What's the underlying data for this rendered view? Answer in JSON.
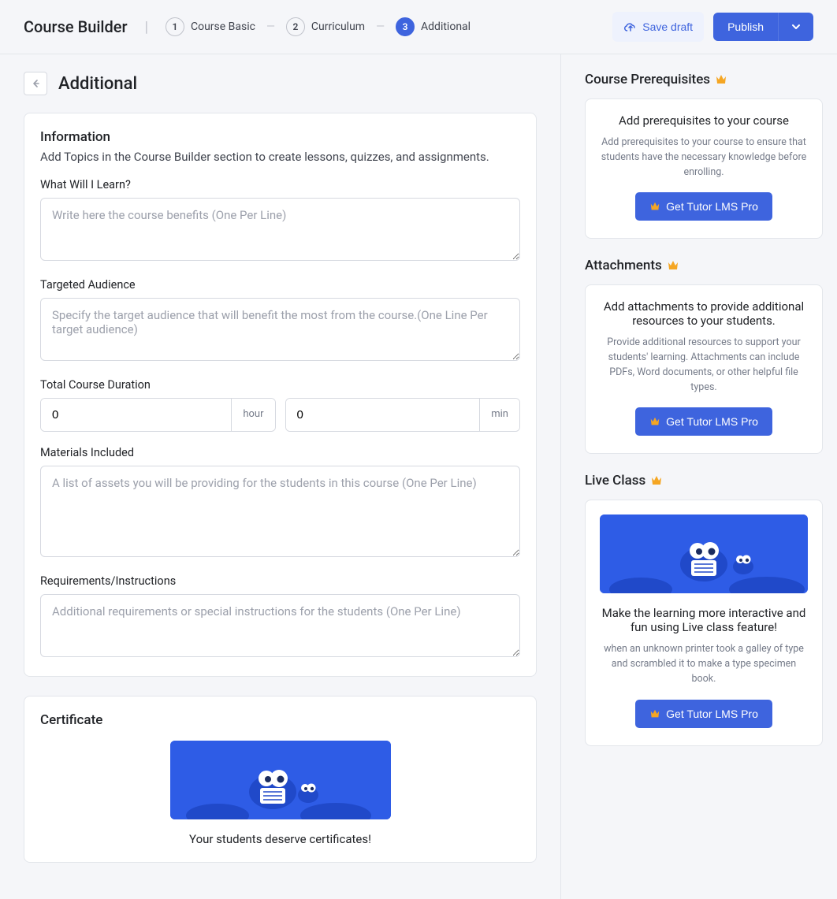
{
  "header": {
    "app_title": "Course Builder",
    "steps": [
      {
        "num": "1",
        "label": "Course Basic"
      },
      {
        "num": "2",
        "label": "Curriculum"
      },
      {
        "num": "3",
        "label": "Additional"
      }
    ],
    "save_draft": "Save draft",
    "publish": "Publish"
  },
  "page_title": "Additional",
  "info_card": {
    "title": "Information",
    "subtitle": "Add Topics in the Course Builder section to create lessons, quizzes, and assignments.",
    "what_learn_label": "What Will I Learn?",
    "what_learn_placeholder": "Write here the course benefits (One Per Line)",
    "audience_label": "Targeted Audience",
    "audience_placeholder": "Specify the target audience that will benefit the most from the course.(One Line Per target audience)",
    "duration_label": "Total Course Duration",
    "hour_value": "0",
    "hour_unit": "hour",
    "min_value": "0",
    "min_unit": "min",
    "materials_label": "Materials Included",
    "materials_placeholder": "A list of assets you will be providing for the students in this course (One Per Line)",
    "reqs_label": "Requirements/Instructions",
    "reqs_placeholder": "Additional requirements or special instructions for the students (One Per Line)"
  },
  "cert_card": {
    "title": "Certificate",
    "caption": "Your students deserve certificates!"
  },
  "side": {
    "prereq": {
      "heading": "Course Prerequisites",
      "title": "Add prerequisites to your course",
      "desc": "Add prerequisites to your course to ensure that students have the necessary knowledge before enrolling.",
      "cta": "Get Tutor LMS Pro"
    },
    "attach": {
      "heading": "Attachments",
      "title": "Add attachments to provide additional resources to your students.",
      "desc": "Provide additional resources to support your students' learning. Attachments can include PDFs, Word documents, or other helpful file types.",
      "cta": "Get Tutor LMS Pro"
    },
    "live": {
      "heading": "Live Class",
      "title": "Make the learning more interactive and fun using Live class feature!",
      "desc": "when an unknown printer took a galley of type and scrambled it to make a type specimen book.",
      "cta": "Get Tutor LMS Pro"
    }
  }
}
